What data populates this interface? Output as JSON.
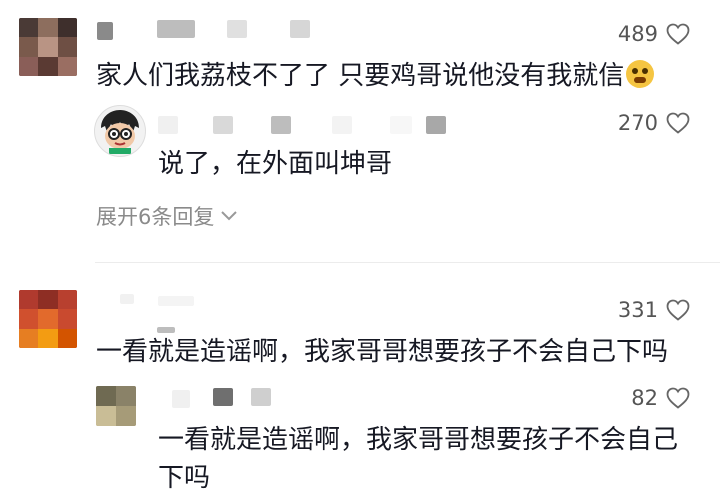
{
  "comments": [
    {
      "likes": "489",
      "text": "家人们我荔枝不了了 只要鸡哥说他没有我就信",
      "emoji": "grimacing-face-emoji",
      "reply": {
        "likes": "270",
        "text": "说了，在外面叫坤哥"
      },
      "expand_label": "展开6条回复"
    },
    {
      "likes": "331",
      "text": "一看就是造谣啊，我家哥哥想要孩子不会自己下吗",
      "reply": {
        "likes": "82",
        "text_line1": "一看就是造谣啊，我家哥哥想要孩子不会自己",
        "text_line2": "下吗"
      }
    }
  ],
  "icons": {
    "like": "heart-outline-icon",
    "expand": "chevron-down-icon"
  },
  "colors": {
    "text": "#161823",
    "meta": "#555555",
    "expand": "#8a8a8a"
  }
}
